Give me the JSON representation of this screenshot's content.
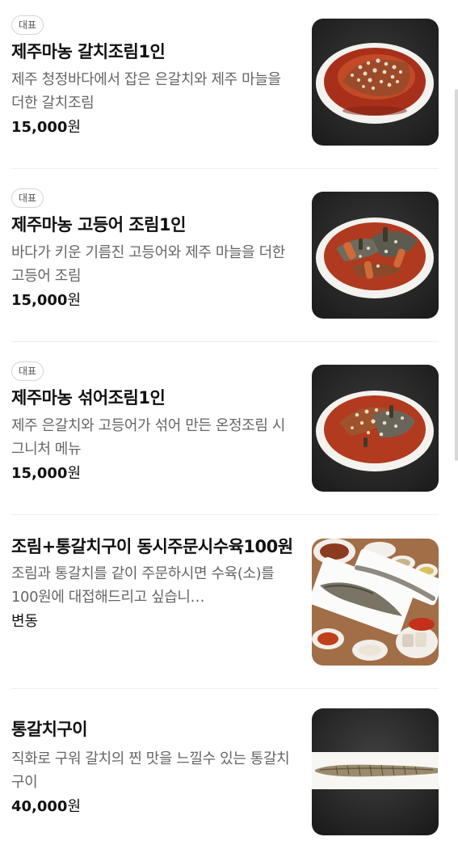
{
  "menu": {
    "items": [
      {
        "badge": "대표",
        "name": "제주마농 갈치조림1인",
        "description": "제주 청정바다에서 잡은 은갈치와 제주 마늘을 더한 갈치조림",
        "price": "15,000",
        "price_unit": "원",
        "image": "braised-cutlassfish-dish-icon"
      },
      {
        "badge": "대표",
        "name": "제주마농 고등어 조림1인",
        "description": "바다가 키운 기름진 고등어와 제주 마늘을 더한 고등어 조림",
        "price": "15,000",
        "price_unit": "원",
        "image": "braised-mackerel-dish-icon"
      },
      {
        "badge": "대표",
        "name": "제주마농 섞어조림1인",
        "description": "제주 은갈치와 고등어가 섞어 만든 온정조림 시그니처 메뉴",
        "price": "15,000",
        "price_unit": "원",
        "image": "mixed-braised-fish-dish-icon"
      },
      {
        "name": "조림+통갈치구이 동시주문시수육100원",
        "description": "조림과 통갈치를 같이 주문하시면 수육(소)를100원에 대접해드리고 싶습니…",
        "price_text": "변동",
        "image": "table-spread-photo-icon"
      },
      {
        "name": "통갈치구이",
        "description": "직화로 구워 갈치의 찐 맛을 느낄수 있는 통갈치 구이",
        "price": "40,000",
        "price_unit": "원",
        "image": "grilled-whole-cutlassfish-icon"
      }
    ]
  },
  "colors": {
    "title": "#111111",
    "description": "#666666",
    "divider": "#eeeeee",
    "badge_border": "#d5d5d5",
    "sauce_red": "#b8321c",
    "dark_plate_bg": "#2b2b2b"
  }
}
